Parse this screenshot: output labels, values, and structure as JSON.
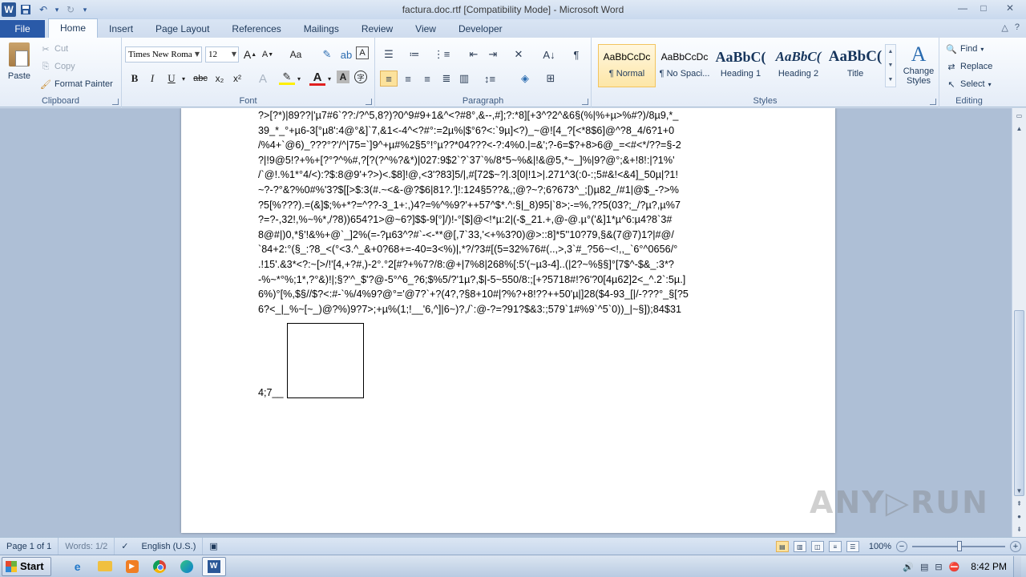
{
  "window": {
    "title": "factura.doc.rtf [Compatibility Mode] - Microsoft Word",
    "controls": {
      "minimize": "—",
      "maximize": "□",
      "close": "✕"
    }
  },
  "qat": {
    "logo": "W",
    "save": "💾",
    "undo": "↶",
    "undo_dd": "▾",
    "redo": "↻",
    "customize": "▾"
  },
  "tabs": [
    "File",
    "Home",
    "Insert",
    "Page Layout",
    "References",
    "Mailings",
    "Review",
    "View",
    "Developer"
  ],
  "active_tab": "Home",
  "tabs_right": {
    "minimize_ribbon": "△",
    "help": "?"
  },
  "clipboard": {
    "group_label": "Clipboard",
    "paste": "Paste",
    "cut": "Cut",
    "copy": "Copy",
    "format_painter": "Format Painter"
  },
  "font": {
    "group_label": "Font",
    "family": "Times New Roma",
    "size": "12",
    "grow": "A",
    "shrink": "A",
    "change_case": "Aa",
    "bold": "B",
    "italic": "I",
    "underline": "U",
    "strike": "abc",
    "subscript": "x₂",
    "superscript": "x²",
    "text_effects": "A",
    "font_color": "A",
    "char_shading": "A",
    "enclose": "字"
  },
  "paragraph": {
    "group_label": "Paragraph",
    "show_marks": "¶"
  },
  "styles": {
    "group_label": "Styles",
    "items": [
      {
        "sample": "AaBbCcDc",
        "name": "¶ Normal",
        "selected": true
      },
      {
        "sample": "AaBbCcDc",
        "name": "¶ No Spaci...",
        "selected": false
      },
      {
        "sample": "AaBbC(",
        "name": "Heading 1",
        "selected": false
      },
      {
        "sample": "AaBbC(",
        "name": "Heading 2",
        "selected": false
      },
      {
        "sample": "AaBbC(",
        "name": "Title",
        "selected": false
      }
    ],
    "change_styles": "Change Styles",
    "change_icon": "A"
  },
  "editing": {
    "group_label": "Editing",
    "find": "Find",
    "replace": "Replace",
    "select": "Select"
  },
  "document": {
    "lines": [
      "?>[?*)|89??|'µ7#6`??:/?^5,8?)?0^9#9+1&^<?#8°,&--,#];?:*8][+3^?2^&6§(%|%+µ>%#?)/8µ9,*_",
      "39_*_°+µ6-3[°µ8':4@°&]`7,&1<-4^<?#°:=2µ%|$°6?<:`9µ]<?)_~@![4_?[<*8$6]@^?8_4/6?1+0",
      "/%4+`@6)_???°?'/^|75=`]9^+µ#%2§5°!°µ??*04???<-?:4%0.|=&';?-6=$?+8>6@_=<#<*/??=§-2",
      "?|!9@5!?+%+[?°?^%#,?[?(?^%?&*)|027:9$2`?`37`%/8*5~%&|!&@5,*~_]%|9?@°;&+!8!:|?1%'",
      "/`@!.%1*°4/<):?$:8@9'+?>)<.$8]!@,<3'?83]5/|,#[72$~?|.3[0|!1>|.271^3(:0-:;5#&!<&4]_50µ|?1!",
      "~?-?°&?%0#%'3?$[[>$:3(#.~<&-@?$6|81?.']!:124§5??&,;@?~?;6?673^_;[)µ82_/#1|@$_-?>%",
      "?5[%???).=(&]$;%+*?=^??-3_1+:,)4?=%^%9?'++57^$*.^:§|_8)95|`8>;-=%,??5(03?;_/?µ?,µ%7",
      "?=?-,32!,%~%*,/?8))654?1>@~6?]$$-9[°]/)!-°[$]@<!*µ:2|(-$_21.+,@-@.µ°('&]1*µ^6:µ4?8`3#",
      "8@#|)0,*§'!&%+@`_]2%(=-?µ63^?#`-<-**@[,7`33,'<+%3?0)@>::8]*5''10?79,§&(7@7)1?|#@/",
      "`84+2:°(§_:?8_<(°<3.^_&+0?68+=-40=3<%)|,*?/?3#[(5=32%76#(..,>,3`#_?56~<!,,_`6°^0656/°",
      ".!15'.&3*<?:~[>/!'[4,+?#,)-2°.°2[#?+%7?/8:@+|7%8|268%[:5'(~µ3-4]..(|2?~%§§]°[7$^-$&_:3*?",
      "-%~*°%;1*,?°&)!|;§?'^_$'?@-5°^6_?6;$%5/?'1µ?,$|-5~550/8:;[+?5718#!?6'?0[4µ62]2<_^.2`:5µ.]",
      "6%)°[%,$§//$?<:#-`%/4%9?@°='@7?`+?(4?,?§8+10#|?%?+8!??++50'µ|]28($4-93_[|/-???°_§[?5",
      "6?<_|_%~[~_)@?%)9?7>;+µ%(1;!__'6,^]|6~)?,/`:@-?=?91?$&3:;579`1#%9`^5`0))_|~§]);84$31"
    ],
    "frame_text": "4;7__"
  },
  "status": {
    "page": "Page 1 of 1",
    "words": "Words: 1/2",
    "language": "English (U.S.)",
    "zoom": "100%",
    "zoom_out": "−",
    "zoom_in": "+"
  },
  "taskbar": {
    "start": "Start",
    "time": "8:42 PM"
  },
  "watermark": "ANY▷RUN"
}
